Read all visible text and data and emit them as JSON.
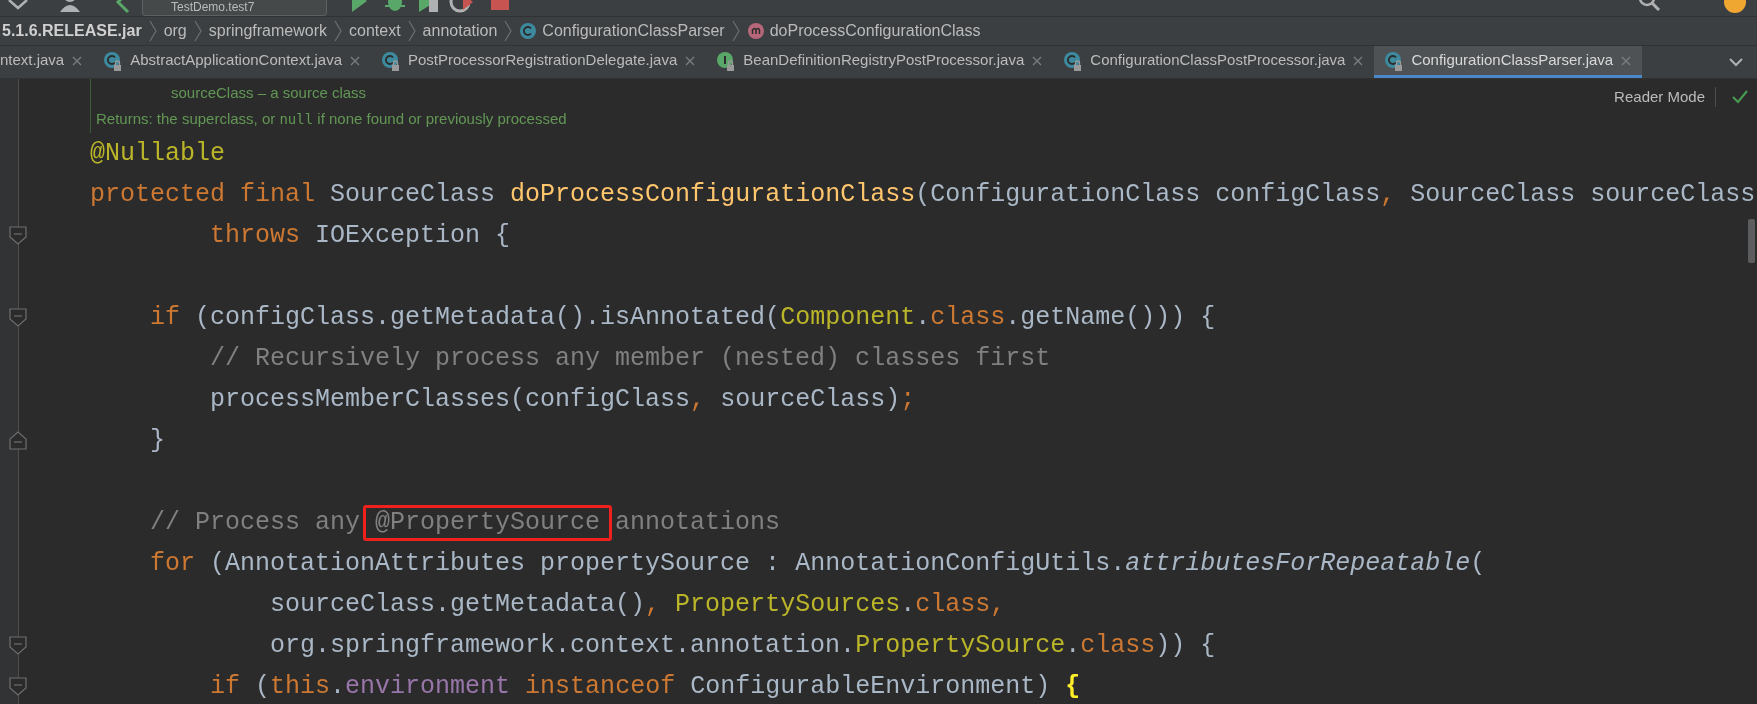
{
  "toolbar": {
    "run_config": "TestDemo.test7"
  },
  "breadcrumbs": [
    {
      "kind": "jar",
      "text": "5.1.6.RELEASE.jar"
    },
    {
      "kind": "package",
      "text": "org"
    },
    {
      "kind": "package",
      "text": "springframework"
    },
    {
      "kind": "package",
      "text": "context"
    },
    {
      "kind": "package",
      "text": "annotation"
    },
    {
      "kind": "class",
      "text": "ConfigurationClassParser"
    },
    {
      "kind": "method",
      "text": "doProcessConfigurationClass"
    }
  ],
  "tabs": [
    {
      "label": "ntext.java",
      "kind": "cut",
      "selected": false
    },
    {
      "label": "AbstractApplicationContext.java",
      "kind": "class",
      "selected": false
    },
    {
      "label": "PostProcessorRegistrationDelegate.java",
      "kind": "class",
      "selected": false
    },
    {
      "label": "BeanDefinitionRegistryPostProcessor.java",
      "kind": "interface",
      "selected": false
    },
    {
      "label": "ConfigurationClassPostProcessor.java",
      "kind": "class",
      "selected": false
    },
    {
      "label": "ConfigurationClassParser.java",
      "kind": "class",
      "selected": true
    }
  ],
  "doc": {
    "param_line": "sourceClass – a source class",
    "returns": [
      {
        "kind": "text",
        "text": "Returns: the superclass, or "
      },
      {
        "kind": "code",
        "text": "null"
      },
      {
        "kind": "text",
        "text": " if none found or previously processed"
      }
    ]
  },
  "reader_mode": {
    "label": "Reader Mode"
  },
  "code_lines": [
    {
      "kind": "code",
      "tokens": [
        {
          "kind": "annotation",
          "text": "@Nullable"
        }
      ]
    },
    {
      "kind": "code",
      "tokens": [
        {
          "kind": "keyword",
          "text": "protected"
        },
        {
          "kind": "keyword",
          "text": " final"
        },
        {
          "kind": "plain",
          "text": " SourceClass "
        },
        {
          "kind": "method",
          "text": "doProcessConfigurationClass"
        },
        {
          "kind": "plain",
          "text": "(ConfigurationClass configClass"
        },
        {
          "kind": "keyword",
          "text": ","
        },
        {
          "kind": "plain",
          "text": " SourceClass sourceClass"
        }
      ]
    },
    {
      "kind": "code",
      "fold_start": true,
      "tokens": [
        {
          "kind": "keyword",
          "text": "        throws"
        },
        {
          "kind": "plain",
          "text": " IOException {"
        }
      ]
    },
    {
      "kind": "blank"
    },
    {
      "kind": "code",
      "fold_start": true,
      "tokens": [
        {
          "kind": "keyword",
          "text": "    if"
        },
        {
          "kind": "plain",
          "text": " (configClass.getMetadata().isAnnotated("
        },
        {
          "kind": "classref",
          "text": "Component"
        },
        {
          "kind": "plain",
          "text": "."
        },
        {
          "kind": "keyword",
          "text": "class"
        },
        {
          "kind": "plain",
          "text": ".getName())) {"
        }
      ]
    },
    {
      "kind": "code",
      "tokens": [
        {
          "kind": "comment",
          "text": "        // Recursively process any member (nested) classes first"
        }
      ]
    },
    {
      "kind": "code",
      "tokens": [
        {
          "kind": "plain",
          "text": "        processMemberClasses(configClass"
        },
        {
          "kind": "keyword",
          "text": ","
        },
        {
          "kind": "plain",
          "text": " sourceClass)"
        },
        {
          "kind": "keyword",
          "text": ";"
        }
      ]
    },
    {
      "kind": "code",
      "fold_end": true,
      "tokens": [
        {
          "kind": "plain",
          "text": "    }"
        }
      ]
    },
    {
      "kind": "blank"
    },
    {
      "kind": "code",
      "tokens": [
        {
          "kind": "comment",
          "text": "    // Process any"
        },
        {
          "kind": "comment",
          "text": " @PropertySource ",
          "highlighted": true
        },
        {
          "kind": "comment",
          "text": "annotations"
        }
      ]
    },
    {
      "kind": "code",
      "tokens": [
        {
          "kind": "keyword",
          "text": "    for"
        },
        {
          "kind": "plain",
          "text": " (AnnotationAttributes propertySource : AnnotationConfigUtils."
        },
        {
          "kind": "italic",
          "text": "attributesForRepeatable"
        },
        {
          "kind": "plain",
          "text": "("
        }
      ]
    },
    {
      "kind": "code",
      "tokens": [
        {
          "kind": "plain",
          "text": "            sourceClass.getMetadata()"
        },
        {
          "kind": "keyword",
          "text": ","
        },
        {
          "kind": "classref",
          "text": " PropertySources"
        },
        {
          "kind": "plain",
          "text": "."
        },
        {
          "kind": "keyword",
          "text": "class"
        },
        {
          "kind": "keyword",
          "text": ","
        }
      ]
    },
    {
      "kind": "code",
      "fold_start": true,
      "tokens": [
        {
          "kind": "plain",
          "text": "            org.springframework.context.annotation."
        },
        {
          "kind": "classref",
          "text": "PropertySource"
        },
        {
          "kind": "plain",
          "text": "."
        },
        {
          "kind": "keyword",
          "text": "class"
        },
        {
          "kind": "plain",
          "text": ")) {"
        }
      ]
    },
    {
      "kind": "code",
      "fold_start": true,
      "tokens": [
        {
          "kind": "keyword",
          "text": "        if"
        },
        {
          "kind": "plain",
          "text": " ("
        },
        {
          "kind": "keyword",
          "text": "this"
        },
        {
          "kind": "plain",
          "text": "."
        },
        {
          "kind": "field",
          "text": "environment"
        },
        {
          "kind": "keyword",
          "text": " instanceof"
        },
        {
          "kind": "plain",
          "text": " ConfigurableEnvironment) "
        },
        {
          "kind": "brace",
          "text": "{"
        }
      ]
    }
  ]
}
